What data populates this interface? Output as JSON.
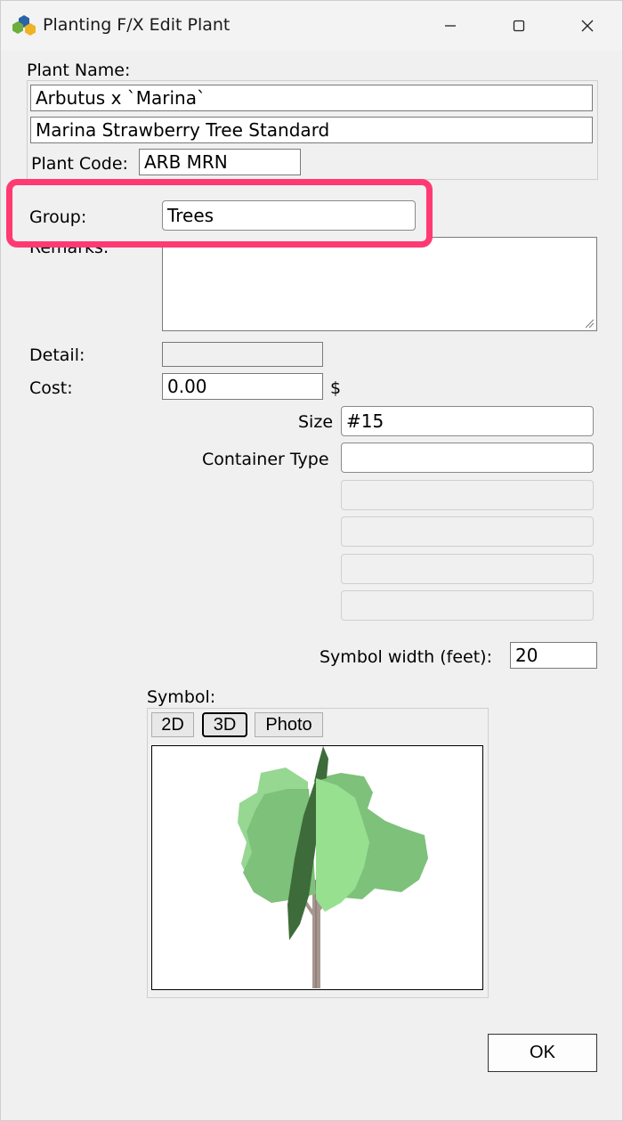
{
  "window": {
    "title": "Planting F/X Edit Plant"
  },
  "plant": {
    "name_label": "Plant Name:",
    "name": "Arbutus x `Marina`",
    "common_name": "Marina Strawberry Tree Standard",
    "code_label": "Plant Code:",
    "code": "ARB MRN"
  },
  "group": {
    "label": "Group:",
    "value": "Trees"
  },
  "remarks": {
    "label": "Remarks:",
    "value": ""
  },
  "detail": {
    "label": "Detail:",
    "value": ""
  },
  "cost": {
    "label": "Cost:",
    "value": "0.00",
    "unit": "$"
  },
  "size": {
    "label": "Size",
    "value": "#15"
  },
  "container": {
    "label": "Container Type",
    "value": "",
    "extra": [
      "",
      "",
      "",
      ""
    ]
  },
  "symbol_width": {
    "label": "Symbol width (feet):",
    "value": "20"
  },
  "symbol": {
    "label": "Symbol:",
    "tabs": [
      "2D",
      "3D",
      "Photo"
    ],
    "active_tab": "3D",
    "preview_icon": "tree-3d-icon"
  },
  "ok_label": "OK",
  "colors": {
    "highlight": "#ff3a72",
    "dialog_bg": "#f0f0f0"
  }
}
